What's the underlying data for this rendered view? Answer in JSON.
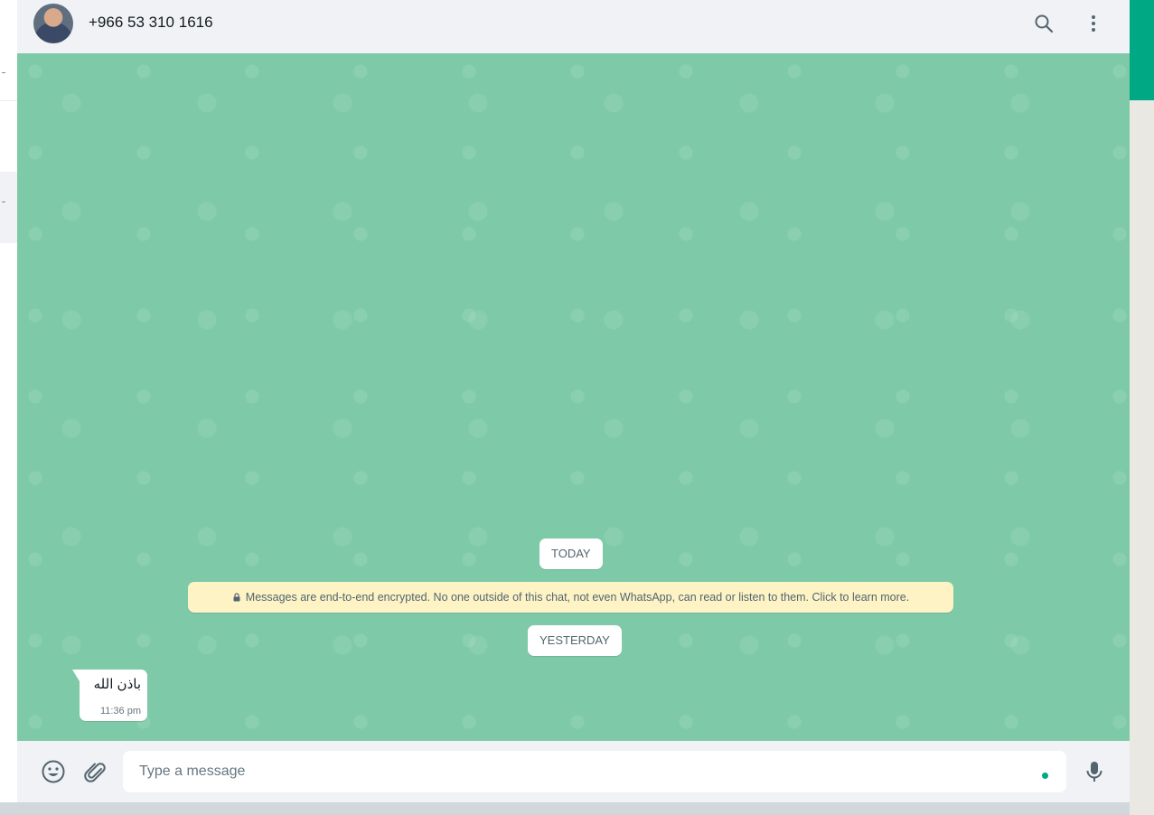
{
  "header": {
    "contact_name": "+966 53 310 1616",
    "search_icon": "search-icon",
    "menu_icon": "more-vertical-icon"
  },
  "conversation": {
    "today_label": "TODAY",
    "encryption_notice": "Messages are end-to-end encrypted. No one outside of this chat, not even WhatsApp, can read or listen to them. Click to learn more.",
    "yesterday_label": "YESTERDAY",
    "messages": [
      {
        "text": "باذن الله",
        "time": "11:36 pm",
        "direction": "incoming"
      }
    ]
  },
  "composer": {
    "placeholder": "Type a message",
    "value": "",
    "emoji_icon": "emoji-icon",
    "attach_icon": "paperclip-icon",
    "mic_icon": "microphone-icon"
  },
  "colors": {
    "accent": "#00a884",
    "wallpaper": "#7ecaa8",
    "header_bg": "#f0f2f5",
    "notice_bg": "#fdf3c5"
  }
}
